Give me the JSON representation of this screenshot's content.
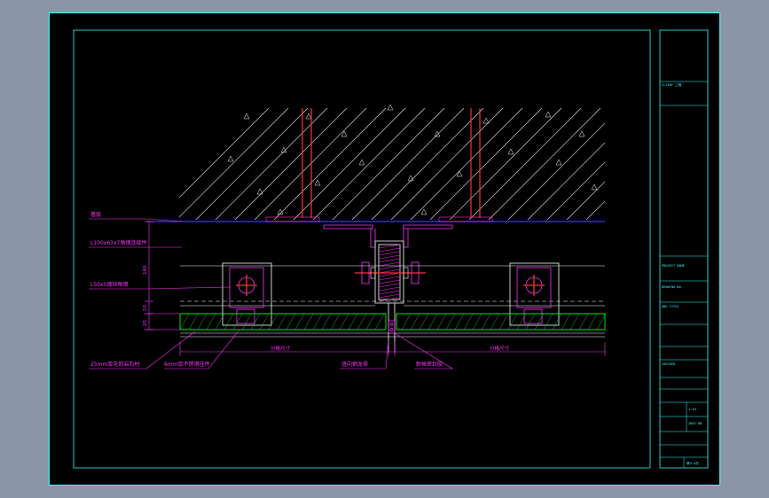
{
  "labels": {
    "base_layer": "基层",
    "steel_angle": "L100x63x7角钢连接件",
    "steel_section": "L50x5镀锌角钢",
    "stone_panel": "25mm厚花岗岩石材",
    "stainless_bracket": "6mm厚不锈钢挂件",
    "vertical_bolt": "竖向钢龙骨",
    "sealant": "耐候密封胶",
    "span_left": "分格尺寸",
    "span_right": "分格尺寸"
  },
  "dimensions": {
    "d1": "140",
    "d2": "10",
    "d3": "25"
  },
  "title_block": {
    "client": "CLIENT 工程",
    "project": "PROJECT NAME",
    "drawing": "DRAWING NO.",
    "dwg_title": "DWG TITLE",
    "checked": "CHECKED",
    "scale": "1:20",
    "date": "2007.08",
    "sheet": "第4-4页"
  },
  "colors": {
    "frame": "#33ffff",
    "annotation": "#ff33ff",
    "hatch": "#ffffff",
    "structure": "#ff3333",
    "panel": "#00ff00",
    "baseline": "#3333ff"
  }
}
